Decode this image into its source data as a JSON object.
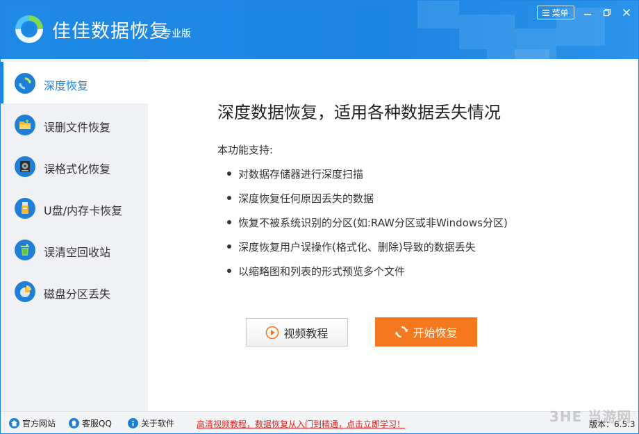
{
  "titlebar": {
    "app_name": "佳佳数据恢复",
    "edition": "专业版",
    "menu_label": "菜单",
    "icons": [
      "app-logo-icon",
      "menu-icon",
      "minimize-icon",
      "restore-icon",
      "close-icon"
    ],
    "background_color": "#1b85e2"
  },
  "sidebar": {
    "items": [
      {
        "label": "深度恢复",
        "icon": "deep-recovery-icon",
        "active": true
      },
      {
        "label": "误删文件恢复",
        "icon": "folder-icon"
      },
      {
        "label": "误格式化恢复",
        "icon": "disk-icon"
      },
      {
        "label": "U盘/内存卡恢复",
        "icon": "usb-drive-icon"
      },
      {
        "label": "误清空回收站",
        "icon": "recycle-bin-icon"
      },
      {
        "label": "磁盘分区丢失",
        "icon": "partition-pie-icon"
      }
    ]
  },
  "main": {
    "headline": "深度数据恢复，适用各种数据丢失情况",
    "support_label": "本功能支持:",
    "features": [
      "对数据存储器进行深度扫描",
      "深度恢复任何原因丢失的数据",
      "恢复不被系统识别的分区(如:RAW分区或非Windows分区)",
      "深度恢复用户误操作(格式化、删除)导致的数据丢失",
      "以缩略图和列表的形式预览多个文件"
    ],
    "video_button": "视频教程",
    "start_button": "开始恢复",
    "accent_color": "#f6781e"
  },
  "statusbar": {
    "links": [
      {
        "label": "官方网站",
        "icon": "home-icon"
      },
      {
        "label": "客服QQ",
        "icon": "qq-icon"
      },
      {
        "label": "关于软件",
        "icon": "info-icon"
      }
    ],
    "promo": "高清视频教程，数据恢复从入门到精通，点击立即学习！",
    "version": "版本：6.5.3"
  },
  "watermark": "3HE 当游网"
}
